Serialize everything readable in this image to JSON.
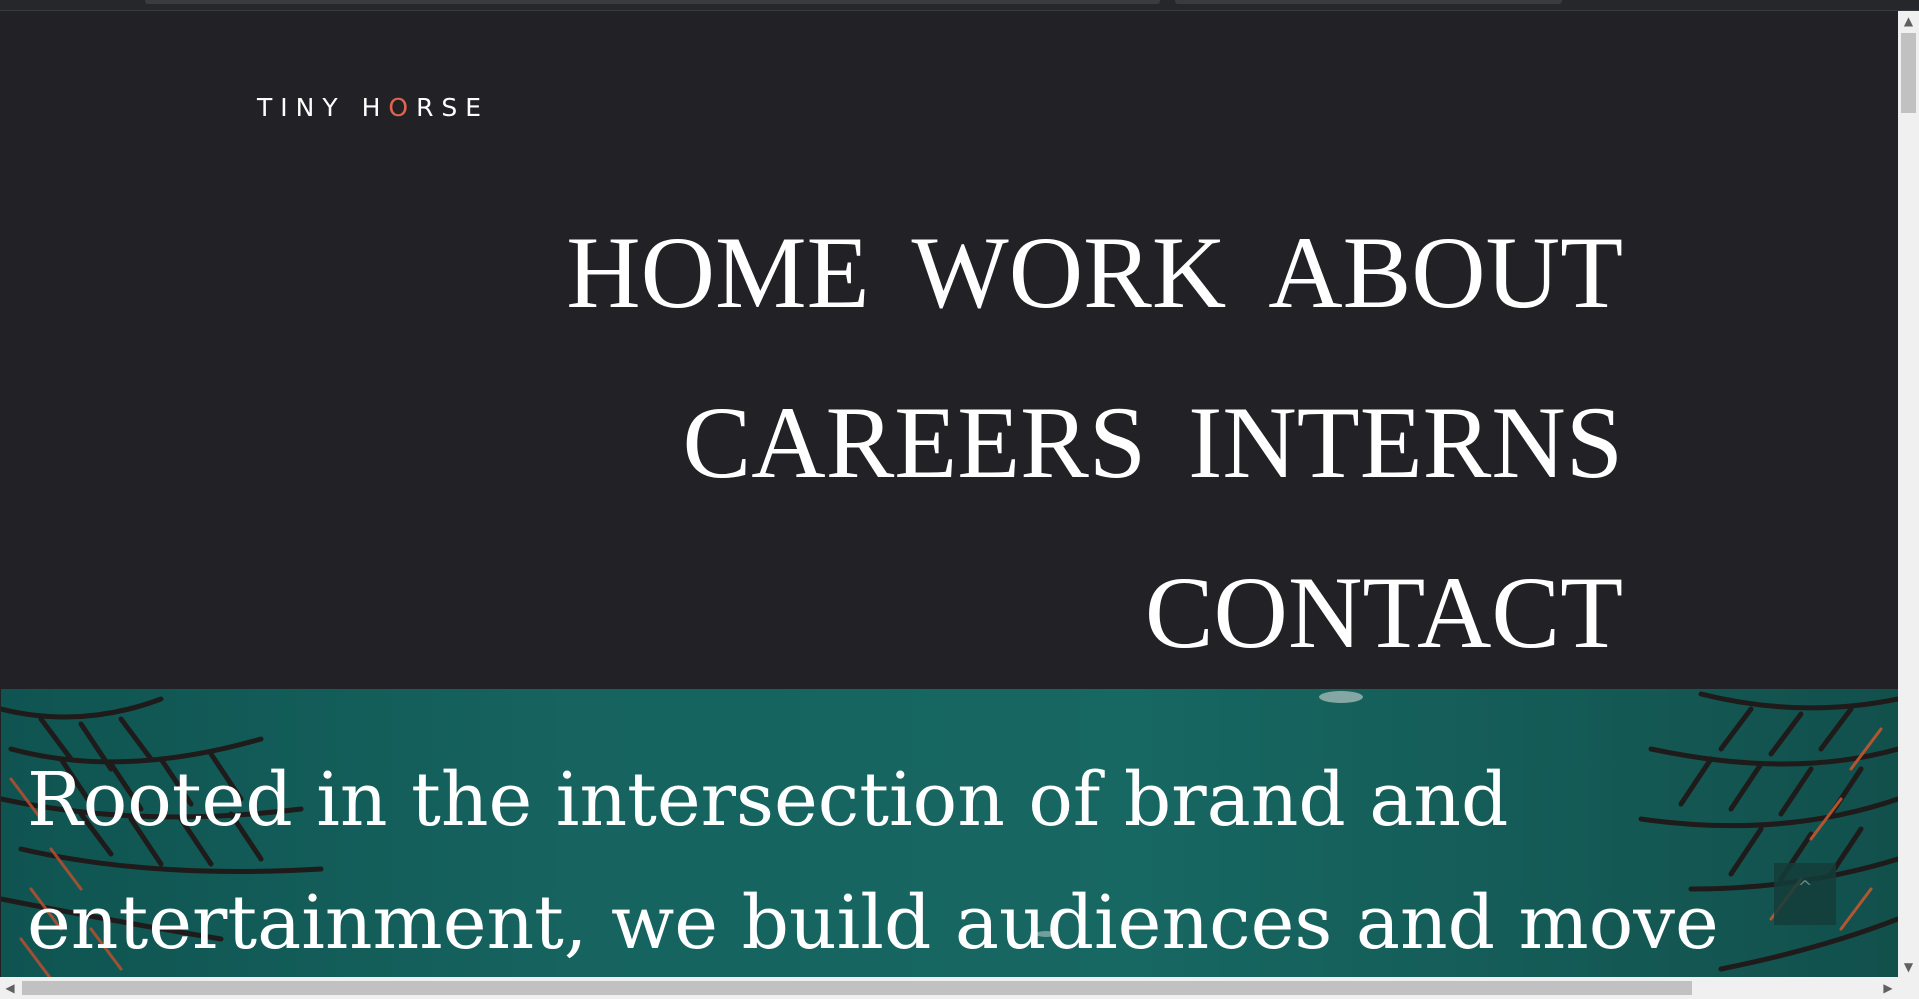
{
  "header": {
    "logo": {
      "part1": "TINY H",
      "accent": "O",
      "part2": "RSE"
    }
  },
  "nav": {
    "rows": [
      [
        "HOME",
        "WORK",
        "ABOUT"
      ],
      [
        "CAREERS",
        "INTERNS"
      ],
      [
        "CONTACT"
      ]
    ]
  },
  "hero": {
    "text": "Rooted in the intersection of brand and entertainment, we build audiences and move"
  },
  "back_to_top": {
    "label": "^"
  },
  "scrollbars": {
    "up": "▲",
    "down": "▼",
    "left": "◀",
    "right": "▶"
  },
  "colors": {
    "background": "#222226",
    "accent": "#e0654f",
    "hero": "#16635f"
  }
}
